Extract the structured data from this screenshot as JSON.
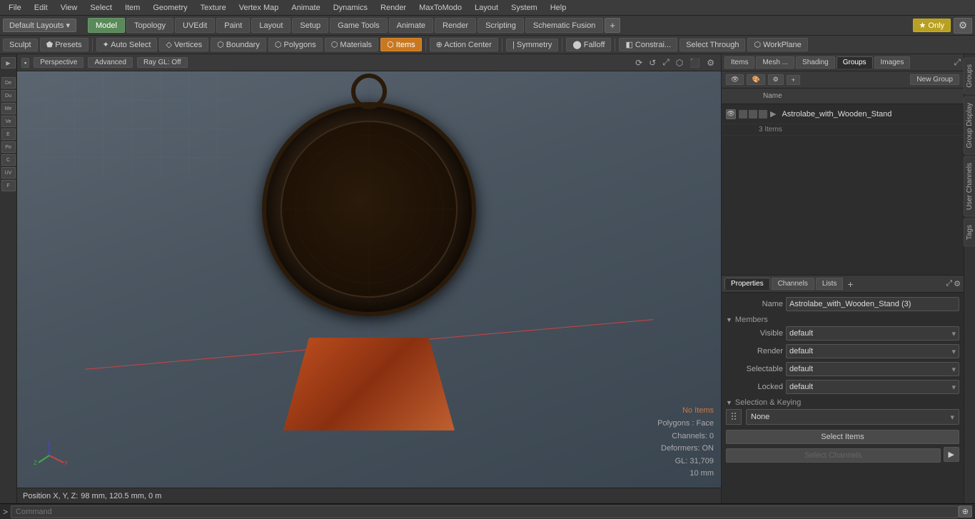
{
  "menu": {
    "items": [
      "File",
      "Edit",
      "View",
      "Select",
      "Item",
      "Geometry",
      "Texture",
      "Vertex Map",
      "Animate",
      "Dynamics",
      "Render",
      "MaxToModo",
      "Layout",
      "System",
      "Help"
    ]
  },
  "toolbar1": {
    "layout_label": "Default Layouts ▾",
    "tabs": [
      "Model",
      "Topology",
      "UVEdit",
      "Paint",
      "Layout",
      "Setup",
      "Game Tools",
      "Animate",
      "Render",
      "Scripting",
      "Schematic Fusion"
    ],
    "active_tab": "Model",
    "add_btn": "+",
    "only_label": "★ Only",
    "settings_label": "⚙"
  },
  "toolbar2": {
    "buttons": [
      "Sculpt",
      "⬟ Presets",
      "✦ Auto Select",
      "◇ Vertices",
      "⬡ Boundary",
      "⬡ Polygons",
      "⬡ Materials",
      "⬡ Items",
      "⊕ Action Center",
      "| Symmetry",
      "⬤ Falloff",
      "◧ Constrai...",
      "Select Through",
      "⬡ WorkPlane"
    ],
    "active": "Items",
    "items_label": "Items",
    "select_through_label": "Select Through"
  },
  "viewport": {
    "mode_label": "Perspective",
    "shading_label": "Advanced",
    "ray_gl": "Ray GL: Off",
    "no_items_label": "No Items",
    "polygons_label": "Polygons : Face",
    "channels_label": "Channels: 0",
    "deformers_label": "Deformers: ON",
    "gl_label": "GL: 31,709",
    "size_label": "10 mm"
  },
  "status_bar": {
    "position_label": "Position X, Y, Z:",
    "position_value": "98 mm, 120.5 mm, 0 m"
  },
  "right_panel": {
    "tabs": [
      "Items",
      "Mesh ...",
      "Shading",
      "Groups",
      "Images"
    ],
    "active_tab": "Groups"
  },
  "groups_panel": {
    "new_group_label": "New Group",
    "columns": [
      "Name"
    ],
    "item": {
      "name": "Astrolabe_with_Wooden_Stand",
      "count": "3 Items"
    }
  },
  "properties_panel": {
    "tabs": [
      "Properties",
      "Channels",
      "Lists"
    ],
    "active_tab": "Properties",
    "name_label": "Name",
    "name_value": "Astrolabe_with_Wooden_Stand (3)",
    "members_section": "Members",
    "visible_label": "Visible",
    "visible_value": "default",
    "render_label": "Render",
    "render_value": "default",
    "selectable_label": "Selectable",
    "selectable_value": "default",
    "locked_label": "Locked",
    "locked_value": "default",
    "selection_section": "Selection & Keying",
    "none_label": "None",
    "select_items_label": "Select Items",
    "select_channels_label": "Select Channels"
  },
  "right_vtabs": [
    "Groups",
    "Group Display",
    "User Channels",
    "Tags"
  ],
  "command_bar": {
    "arrow": ">",
    "placeholder": "Command",
    "icon": "⊕"
  }
}
